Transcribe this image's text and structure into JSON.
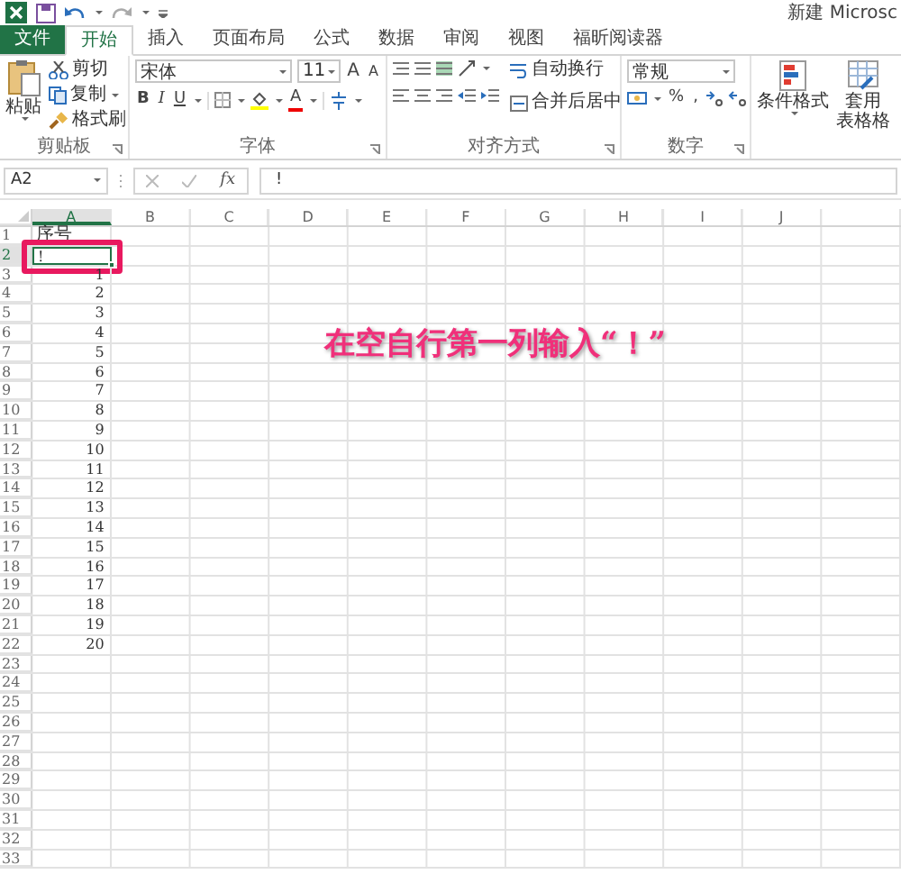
{
  "window": {
    "title": "新建 Microsc"
  },
  "tabs": [
    {
      "label": "文件",
      "kind": "file",
      "selected": false
    },
    {
      "label": "开始",
      "kind": "tab",
      "selected": true
    },
    {
      "label": "插入",
      "kind": "tab",
      "selected": false
    },
    {
      "label": "页面布局",
      "kind": "tab",
      "selected": false
    },
    {
      "label": "公式",
      "kind": "tab",
      "selected": false
    },
    {
      "label": "数据",
      "kind": "tab",
      "selected": false
    },
    {
      "label": "审阅",
      "kind": "tab",
      "selected": false
    },
    {
      "label": "视图",
      "kind": "tab",
      "selected": false
    },
    {
      "label": "福昕阅读器",
      "kind": "tab",
      "selected": false
    }
  ],
  "clipboard": {
    "label": "剪贴板",
    "paste": "粘贴",
    "cut": "剪切",
    "copy": "复制",
    "format_painter": "格式刷"
  },
  "font": {
    "label": "字体",
    "font_name": "宋体",
    "font_size": "11",
    "grow": "A",
    "shrink": "A",
    "bold": "B",
    "italic": "I",
    "underline": "U",
    "font_color": "A"
  },
  "alignment": {
    "label": "对齐方式",
    "wrap_text": "自动换行",
    "merge_center": "合并后居中"
  },
  "number": {
    "label": "数字",
    "format": "常规",
    "percent": "%",
    "comma": ","
  },
  "styles": {
    "conditional_format": "条件格式",
    "table_format_1": "套用",
    "table_format_2": "表格格"
  },
  "formula_bar": {
    "name_box": "A2",
    "fx": "fx",
    "value": "!"
  },
  "sheet": {
    "columns": [
      {
        "label": "A",
        "selected": true
      },
      {
        "label": "B",
        "selected": false
      },
      {
        "label": "C",
        "selected": false
      },
      {
        "label": "D",
        "selected": false
      },
      {
        "label": "E",
        "selected": false
      },
      {
        "label": "F",
        "selected": false
      },
      {
        "label": "G",
        "selected": false
      },
      {
        "label": "H",
        "selected": false
      },
      {
        "label": "I",
        "selected": false
      },
      {
        "label": "J",
        "selected": false
      }
    ],
    "rows": [
      {
        "number": "1",
        "value": "序号",
        "kind": "text",
        "selected": false
      },
      {
        "number": "2",
        "value": "!",
        "kind": "text",
        "selected": true
      },
      {
        "number": "3",
        "value": "1",
        "kind": "number",
        "selected": false
      },
      {
        "number": "4",
        "value": "2",
        "kind": "number",
        "selected": false
      },
      {
        "number": "5",
        "value": "3",
        "kind": "number",
        "selected": false
      },
      {
        "number": "6",
        "value": "4",
        "kind": "number",
        "selected": false
      },
      {
        "number": "7",
        "value": "5",
        "kind": "number",
        "selected": false
      },
      {
        "number": "8",
        "value": "6",
        "kind": "number",
        "selected": false
      },
      {
        "number": "9",
        "value": "7",
        "kind": "number",
        "selected": false
      },
      {
        "number": "10",
        "value": "8",
        "kind": "number",
        "selected": false
      },
      {
        "number": "11",
        "value": "9",
        "kind": "number",
        "selected": false
      },
      {
        "number": "12",
        "value": "10",
        "kind": "number",
        "selected": false
      },
      {
        "number": "13",
        "value": "11",
        "kind": "number",
        "selected": false
      },
      {
        "number": "14",
        "value": "12",
        "kind": "number",
        "selected": false
      },
      {
        "number": "15",
        "value": "13",
        "kind": "number",
        "selected": false
      },
      {
        "number": "16",
        "value": "14",
        "kind": "number",
        "selected": false
      },
      {
        "number": "17",
        "value": "15",
        "kind": "number",
        "selected": false
      },
      {
        "number": "18",
        "value": "16",
        "kind": "number",
        "selected": false
      },
      {
        "number": "19",
        "value": "17",
        "kind": "number",
        "selected": false
      },
      {
        "number": "20",
        "value": "18",
        "kind": "number",
        "selected": false
      },
      {
        "number": "21",
        "value": "19",
        "kind": "number",
        "selected": false
      },
      {
        "number": "22",
        "value": "20",
        "kind": "number",
        "selected": false
      },
      {
        "number": "23"
      },
      {
        "number": "24"
      },
      {
        "number": "25"
      },
      {
        "number": "26"
      },
      {
        "number": "27"
      },
      {
        "number": "28"
      },
      {
        "number": "29"
      },
      {
        "number": "30"
      },
      {
        "number": "31"
      },
      {
        "number": "32"
      },
      {
        "number": "33"
      }
    ]
  },
  "annotation": {
    "text": "在空自行第一列输入“！”"
  }
}
